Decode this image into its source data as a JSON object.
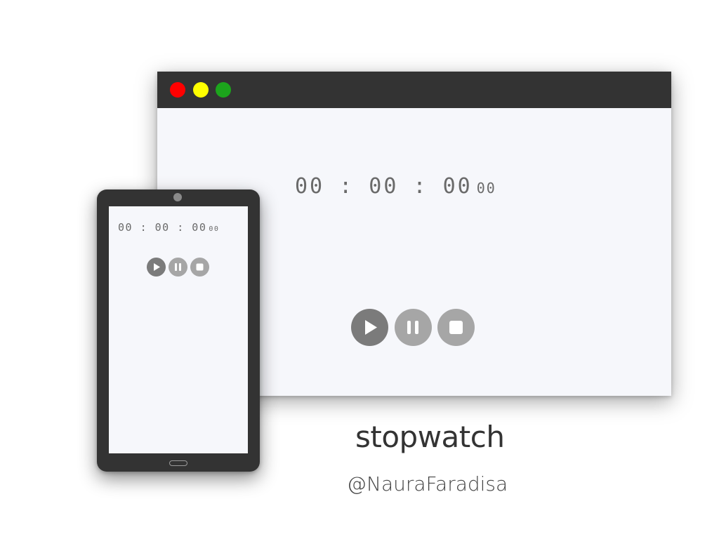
{
  "desktop": {
    "window_controls": {
      "close_color": "#ff0000",
      "minimize_color": "#ffff00",
      "maximize_color": "#1ca51c"
    },
    "timer": {
      "main": "00 : 00 : 00",
      "centiseconds": "00"
    },
    "controls": {
      "play_icon": "play-icon",
      "pause_icon": "pause-icon",
      "stop_icon": "stop-icon"
    }
  },
  "tablet": {
    "timer": {
      "main": "00 : 00 : 00",
      "centiseconds": "00"
    },
    "controls": {
      "play_icon": "play-icon",
      "pause_icon": "pause-icon",
      "stop_icon": "stop-icon"
    }
  },
  "caption": {
    "title": "stopwatch",
    "author": "@NauraFaradisa"
  },
  "colors": {
    "frame": "#333333",
    "screen_bg": "#f6f7fb",
    "play_button": "#7b7b7b",
    "secondary_button": "#a6a6a6",
    "timer_text": "#6a6a6a"
  }
}
